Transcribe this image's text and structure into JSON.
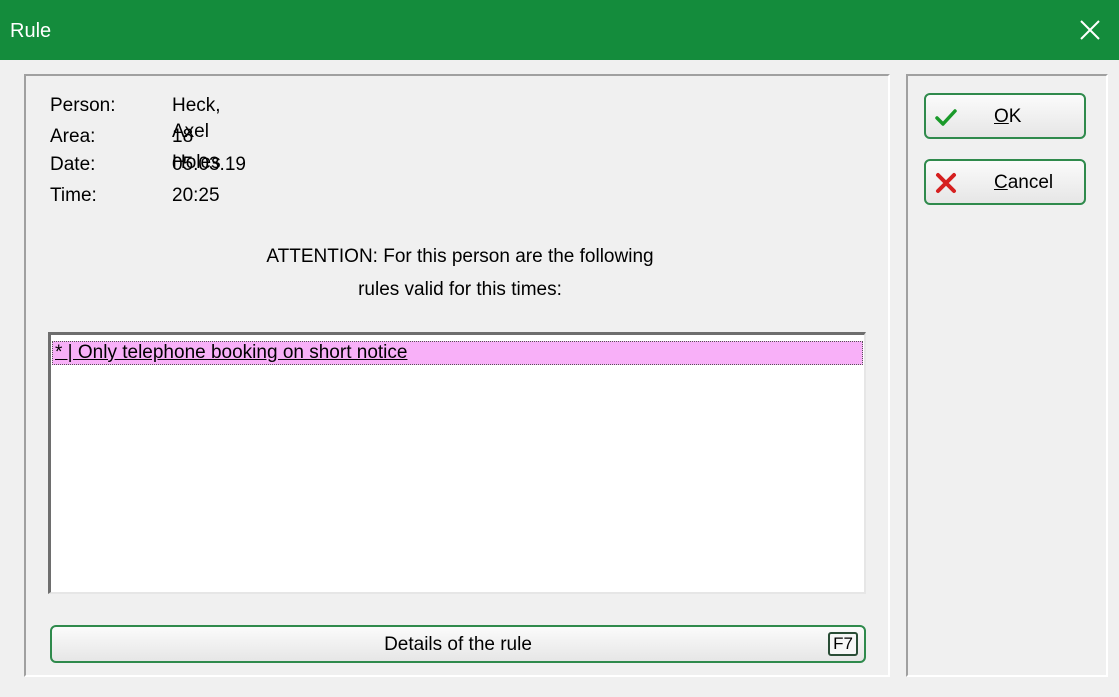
{
  "window": {
    "title": "Rule",
    "titlebar_color": "#148c3c"
  },
  "info": [
    {
      "label": "Person:",
      "value": "Heck, Axel"
    },
    {
      "label": "Area:",
      "value": "18 Holes"
    },
    {
      "label": "Date:",
      "value": "05.03.19"
    },
    {
      "label": "Time:",
      "value": "20:25"
    }
  ],
  "attention": {
    "line1": "ATTENTION: For this person are the following",
    "line2": "rules valid for this times:"
  },
  "rules_list": {
    "items": [
      {
        "text": "* | Only telephone booking on short notice",
        "selected": true,
        "highlight_color": "#f8b0f8"
      }
    ]
  },
  "details_button": {
    "label": "Details of the rule",
    "shortcut": "F7"
  },
  "ok_button": {
    "icon": "checkmark-icon",
    "accel": "O",
    "rest": "K"
  },
  "cancel_button": {
    "icon": "cross-icon",
    "accel": "C",
    "rest": "ancel"
  }
}
